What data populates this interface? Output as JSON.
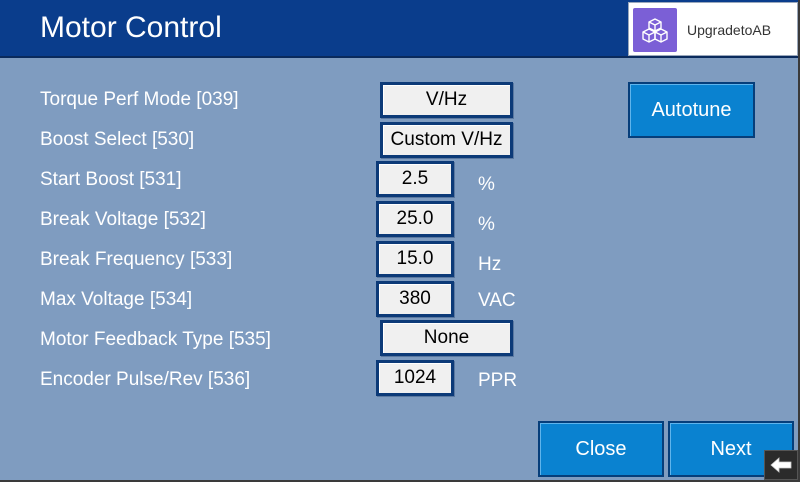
{
  "header": {
    "title": "Motor Control",
    "logo_text": "UpgradetoAB",
    "logo_icon": "cubes-icon"
  },
  "params": [
    {
      "label": "Torque Perf Mode [039]",
      "value": "V/Hz",
      "unit": ""
    },
    {
      "label": "Boost Select [530]",
      "value": "Custom V/Hz",
      "unit": ""
    },
    {
      "label": "Start Boost [531]",
      "value": "2.5",
      "unit": "%"
    },
    {
      "label": "Break Voltage [532]",
      "value": "25.0",
      "unit": "%"
    },
    {
      "label": "Break Frequency [533]",
      "value": "15.0",
      "unit": "Hz"
    },
    {
      "label": "Max Voltage [534]",
      "value": "380",
      "unit": "VAC"
    },
    {
      "label": "Motor Feedback Type [535]",
      "value": "None",
      "unit": ""
    },
    {
      "label": "Encoder Pulse/Rev [536]",
      "value": "1024",
      "unit": "PPR"
    }
  ],
  "buttons": {
    "autotune": "Autotune",
    "close": "Close",
    "next": "Next"
  },
  "colors": {
    "background": "#7f9cc0",
    "header": "#0a3d8c",
    "button": "#0a82d0",
    "logo_tile": "#7b5fd6"
  }
}
